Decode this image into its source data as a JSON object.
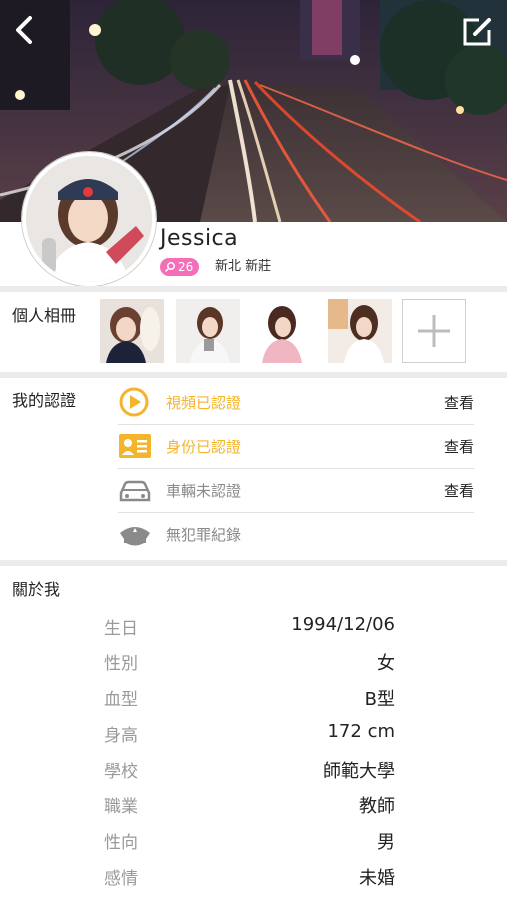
{
  "profile": {
    "name": "Jessica",
    "age": "26",
    "location": "新北 新莊"
  },
  "album": {
    "title": "個人相冊"
  },
  "certification": {
    "title": "我的認證",
    "items": [
      {
        "label": "視頻已認證",
        "action": "查看",
        "icon": "play-icon",
        "color": "#f4b42c"
      },
      {
        "label": "身份已認證",
        "action": "查看",
        "icon": "id-card-icon",
        "color": "#f4b42c"
      },
      {
        "label": "車輛未認證",
        "action": "查看",
        "icon": "car-icon",
        "color": "#8a8a8a"
      },
      {
        "label": "無犯罪紀錄",
        "action": "",
        "icon": "police-cap-icon",
        "color": "#8a8a8a"
      }
    ]
  },
  "about": {
    "title": "關於我",
    "rows": [
      {
        "key": "生日",
        "value": "1994/12/06"
      },
      {
        "key": "性別",
        "value": "女"
      },
      {
        "key": "血型",
        "value": "B型"
      },
      {
        "key": "身高",
        "value": "172 cm"
      },
      {
        "key": "學校",
        "value": "師範大學"
      },
      {
        "key": "職業",
        "value": "教師"
      },
      {
        "key": "性向",
        "value": "男"
      },
      {
        "key": "感情",
        "value": "未婚"
      }
    ]
  },
  "colors": {
    "accent_yellow": "#f4b42c",
    "badge_pink": "#f36fb7",
    "muted_gray": "#8a8a8a"
  }
}
